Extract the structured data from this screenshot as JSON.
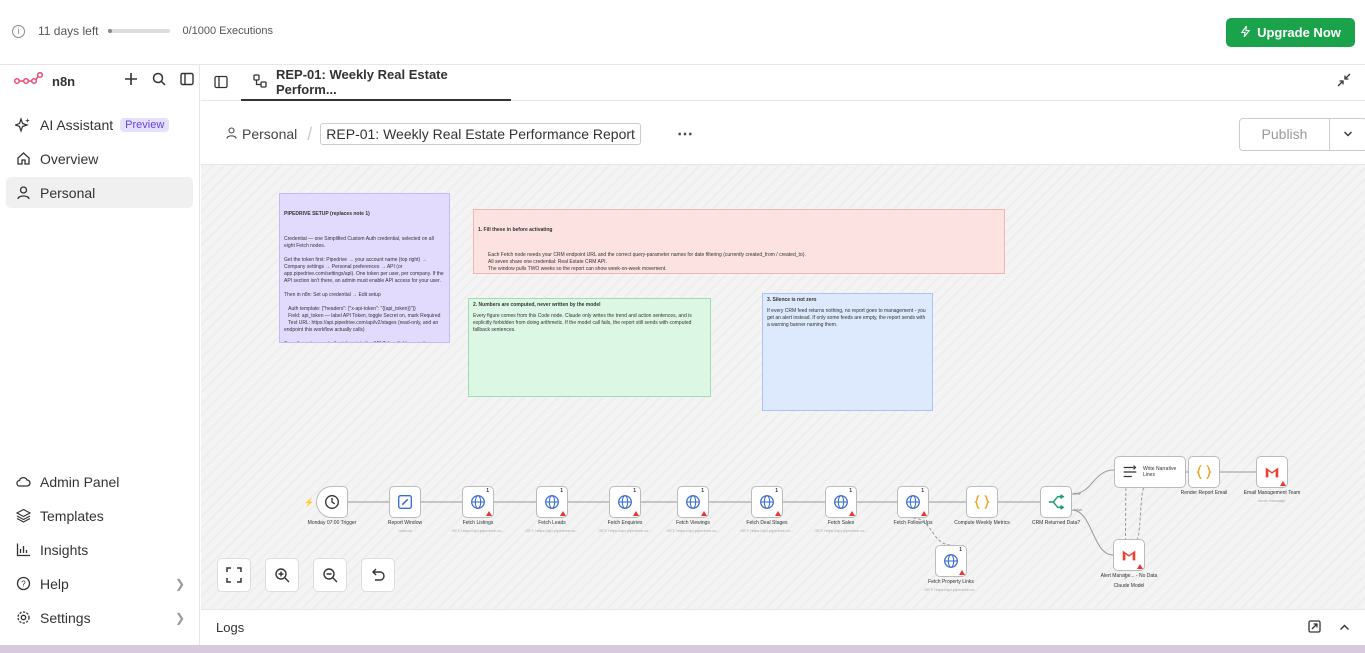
{
  "topbar": {
    "trial_text": "11 days left",
    "trial_progress": 0.05,
    "executions": "0/1000 Executions",
    "upgrade_label": "Upgrade Now"
  },
  "sidebar": {
    "brand": "n8n",
    "nav": [
      {
        "label": "AI Assistant",
        "badge": "Preview"
      },
      {
        "label": "Overview"
      },
      {
        "label": "Personal"
      }
    ],
    "bottom": [
      {
        "label": "Admin Panel"
      },
      {
        "label": "Templates"
      },
      {
        "label": "Insights"
      },
      {
        "label": "Help"
      },
      {
        "label": "Settings"
      }
    ]
  },
  "tab": {
    "label": "REP-01: Weekly Real Estate Perform..."
  },
  "header": {
    "project": "Personal",
    "workflow_title": "REP-01: Weekly Real Estate Performance Report",
    "more": "⋯",
    "publish_label": "Publish"
  },
  "notes": {
    "pipedrive": {
      "title": "PIPEDRIVE SETUP (replaces note 1)",
      "body": "Credential — one Simplified Custom Auth credential, selected on all eight Fetch nodes.\n\nGet the token first: Pipedrive → your account name (top right) → Company settings → Personal preferences → API (or app.pipedrive.com/settings/api). One token per user, per company. If the API section isn't there, an admin must enable API access for your user.\n\nThen in n8n: Set up credential → Edit setup\n\n   Auth template: {\"headers\": {\"x-api-token\": \"{{api_token}}\"}}\n   Field: api_token — label API Token, toggle Secret on, mark Required\n   Test URL: https://api.pipedrive.com/api/v2/stages (read-only, and an endpoint this workflow actually calls)\n\nSave the setup, paste the token into the API Token field, name it"
    },
    "fill": {
      "title": "1. Fill these in before activating",
      "body": "Each Fetch node needs your CRM endpoint URL and the correct query-parameter names for date filtering (currently created_from / created_to).\nAll seven share one credential: Real Estate CRM API.\nThe window pulls TWO weeks so the report can show week-on-week movement."
    },
    "numbers": {
      "title": "2. Numbers are computed, never written by the model",
      "body": "Every figure comes from this Code node. Claude only writes the trend and action sentences, and is explicitly forbidden from doing arithmetic. If the model call fails, the report still sends with computed fallback sentences."
    },
    "silence": {
      "title": "3. Silence is not zero",
      "body": "If every CRM feed returns nothing, no report goes to management - you get an alert instead. If only some feeds are empty, the report sends with a warning banner naming them."
    }
  },
  "nodes": [
    {
      "label": "Monday 07:00 Trigger",
      "sub": "",
      "icon": "clock-icon"
    },
    {
      "label": "Report Window",
      "sub": "manual",
      "icon": "pencil-icon"
    },
    {
      "label": "Fetch Listings",
      "sub": "GET: https://api.pipedrive.co...",
      "icon": "globe-icon"
    },
    {
      "label": "Fetch Leads",
      "sub": "GET: https://api.pipedrive.co...",
      "icon": "globe-icon"
    },
    {
      "label": "Fetch Enquiries",
      "sub": "GET: https://api.pipedrive.co...",
      "icon": "globe-icon"
    },
    {
      "label": "Fetch Viewings",
      "sub": "GET: https://api.pipedrive.co...",
      "icon": "globe-icon"
    },
    {
      "label": "Fetch Deal Stages",
      "sub": "GET: https://api.pipedrive.co...",
      "icon": "globe-icon"
    },
    {
      "label": "Fetch Sales",
      "sub": "GET: https://api.pipedrive.co...",
      "icon": "globe-icon"
    },
    {
      "label": "Fetch Follow-Ups",
      "sub": "",
      "icon": "globe-icon"
    },
    {
      "label": "Compute Weekly Metrics",
      "sub": "",
      "icon": "code-icon"
    },
    {
      "label": "CRM Returned Data?",
      "sub": "",
      "icon": "if-icon"
    },
    {
      "label": "Write Narrative Lines",
      "sub": "",
      "icon": "ai-icon"
    },
    {
      "label": "Render Report Email",
      "sub": "",
      "icon": "code-icon"
    },
    {
      "label": "Email Management Team",
      "sub": "send: message",
      "icon": "gmail-icon"
    },
    {
      "label": "Fetch Property Links",
      "sub": "GET: https://api.pipedrive.co...",
      "icon": "globe-icon"
    },
    {
      "label": "Alert Manage... - No Data",
      "sub": "",
      "icon": "gmail-icon"
    },
    {
      "label": "Claude Model",
      "sub": "",
      "icon": "model-icon"
    }
  ],
  "if_branches": [
    "true",
    "false"
  ],
  "node_badge": "1",
  "logs": {
    "label": "Logs"
  },
  "colors": {
    "accent": "#1aa34a",
    "brand": "#ea4b71",
    "purple_note": "#e3dbfd",
    "red_note": "#fde2e2",
    "green_note": "#dcf8e4",
    "blue_note": "#dde9fd"
  }
}
